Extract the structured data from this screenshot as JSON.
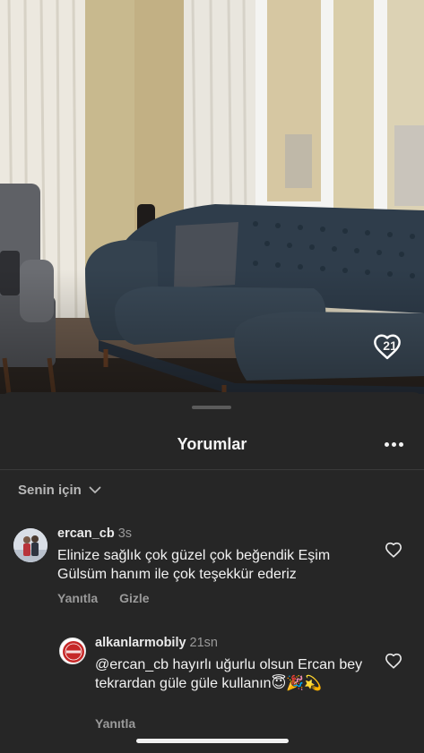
{
  "video": {
    "like_count": "21"
  },
  "sheet": {
    "title": "Yorumlar",
    "filter_label": "Senin için"
  },
  "comments": [
    {
      "username": "ercan_cb",
      "time": "3s",
      "text": "Elinize sağlık çok güzel çok beğendik Eşim Gülsüm hanım ile çok teşekkür ederiz",
      "reply_label": "Yanıtla",
      "hide_label": "Gizle"
    }
  ],
  "replies": [
    {
      "username": "alkanlarmobily",
      "time": "21sn",
      "text": "@ercan_cb hayırlı uğurlu olsun Ercan bey tekrardan güle güle kullanın😇🎉💫",
      "reply_label": "Yanıtla",
      "avatar_logo_text": "ALKANLAR MOBİLYA"
    }
  ],
  "icons": {
    "like": "heart-outline-icon",
    "more": "more-horizontal-icon",
    "filter_chevron": "chevron-down-icon"
  },
  "colors": {
    "sheet_background": "#262626",
    "text_primary": "#f5f5f5",
    "text_secondary": "#9a9a9a",
    "brand_red": "#c62828"
  }
}
